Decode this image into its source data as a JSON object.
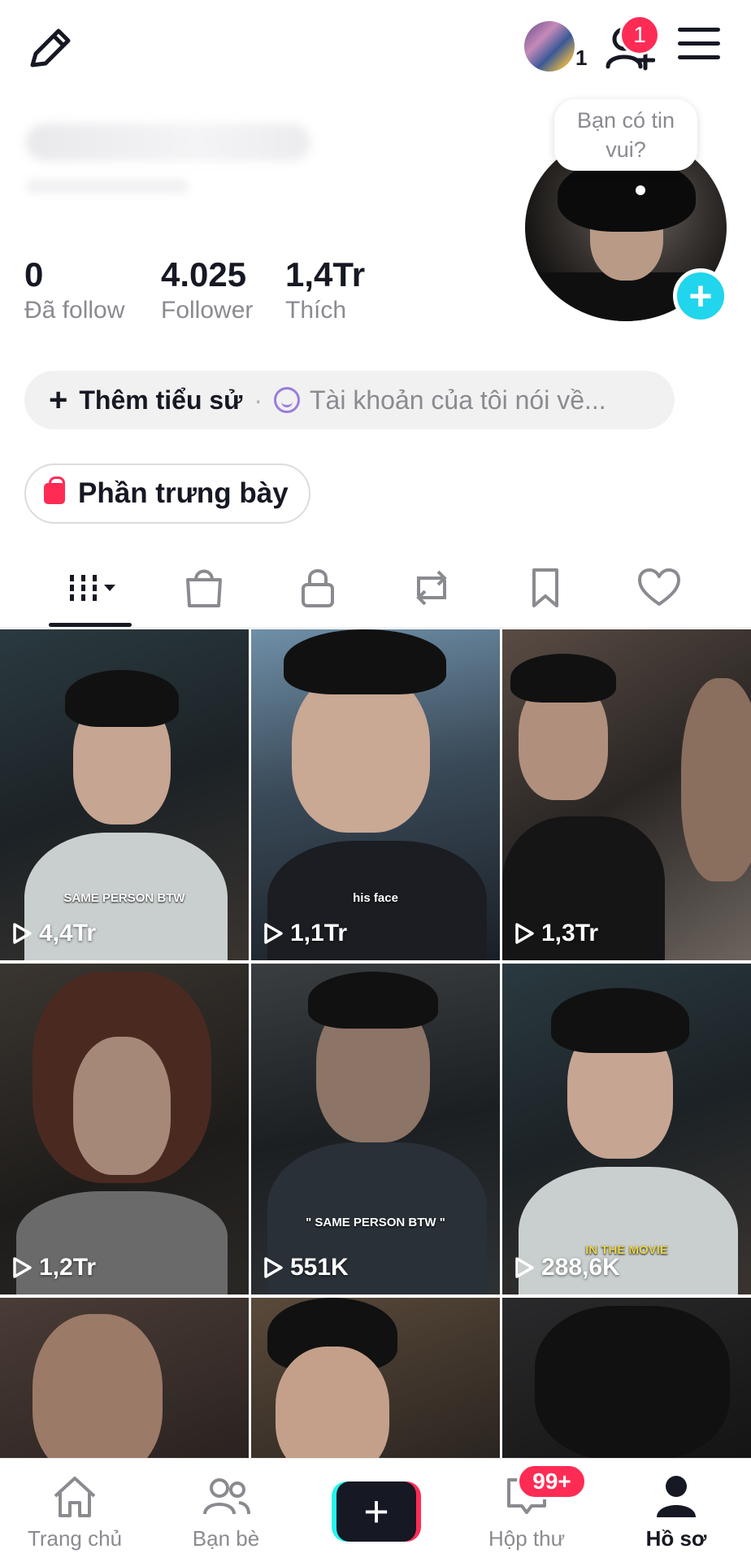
{
  "header": {
    "stories_count": "1",
    "notification_count": "1"
  },
  "profile": {
    "bubble_text": "Bạn có tin vui?",
    "stats": [
      {
        "value": "0",
        "label": "Đã follow"
      },
      {
        "value": "4.025",
        "label": "Follower"
      },
      {
        "value": "1,4Tr",
        "label": "Thích"
      }
    ],
    "bio_add_label": "Thêm tiểu sử",
    "bio_separator": "·",
    "bio_hint": "Tài khoản của tôi nói về...",
    "showcase_label": "Phần trưng bày"
  },
  "tabs": [
    {
      "icon": "grid-icon",
      "active": true
    },
    {
      "icon": "shopping-bag-icon"
    },
    {
      "icon": "lock-icon"
    },
    {
      "icon": "repost-icon"
    },
    {
      "icon": "bookmark-icon"
    },
    {
      "icon": "heart-icon"
    }
  ],
  "videos": [
    {
      "views": "4,4Tr",
      "caption": "SAME PERSON BTW"
    },
    {
      "views": "1,1Tr",
      "caption": "his face"
    },
    {
      "views": "1,3Tr",
      "caption": ""
    },
    {
      "views": "1,2Tr",
      "caption": ""
    },
    {
      "views": "551K",
      "caption": "\" SAME PERSON BTW \""
    },
    {
      "views": "288,6K",
      "caption": "IN THE MOVIE"
    },
    {
      "views": "",
      "caption": ""
    },
    {
      "views": "",
      "caption": ""
    },
    {
      "views": "",
      "caption": ""
    }
  ],
  "bottom_nav": {
    "home": "Trang chủ",
    "friends": "Bạn bè",
    "create": "+",
    "inbox": "Hộp thư",
    "inbox_badge": "99+",
    "profile": "Hồ sơ"
  },
  "colors": {
    "accent_pink": "#fe2c55",
    "accent_cyan": "#20d5ec",
    "text_primary": "#161823",
    "text_secondary": "#8a8b91"
  }
}
